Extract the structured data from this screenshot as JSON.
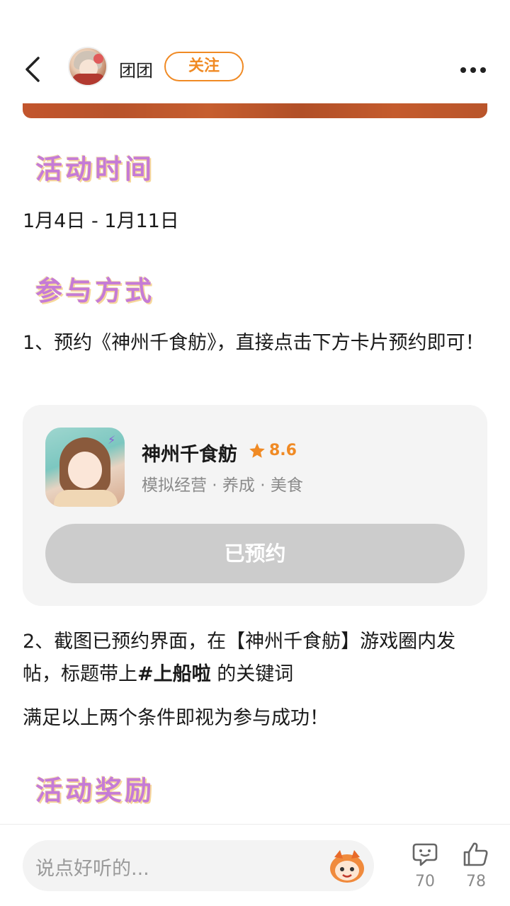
{
  "header": {
    "username": "团团",
    "follow_label": "关注"
  },
  "sections": {
    "time_title": "活动时间",
    "date_range": "1月4日 - 1月11日",
    "method_title": "参与方式",
    "step1": "1、预约《神州千食舫》，直接点击下方卡片预约即可！",
    "step2_prefix": "2、截图已预约界面，在【神州千食舫】游戏圈内发帖，标题带上",
    "step2_keyword": "#上船啦",
    "step2_suffix": " 的关键词",
    "condition": "满足以上两个条件即视为参与成功！",
    "reward_title": "活动奖励"
  },
  "game_card": {
    "name": "神州千食舫",
    "rating": "8.6",
    "tags": "模拟经营 · 养成 · 美食",
    "button_label": "已预约"
  },
  "bottom_bar": {
    "comment_placeholder": "说点好听的...",
    "comment_count": "70",
    "like_count": "78"
  },
  "colors": {
    "accent": "#f08a24",
    "title_purple": "#c57bd6",
    "card_bg": "#f4f4f4",
    "button_disabled": "#cccccc"
  },
  "icons": [
    "back-arrow-icon",
    "more-icon",
    "star-icon",
    "comment-icon",
    "thumbs-up-icon",
    "mascot-icon"
  ]
}
